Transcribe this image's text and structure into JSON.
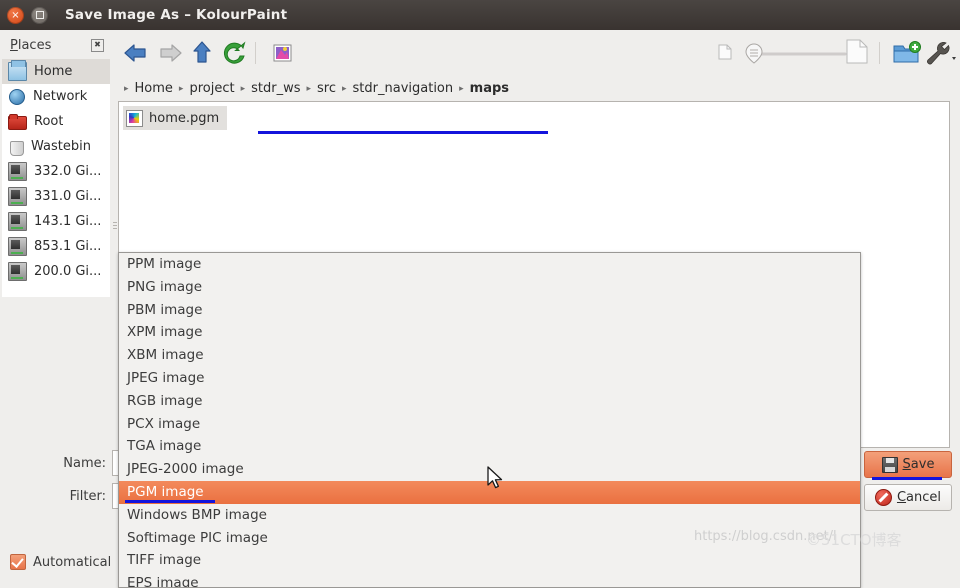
{
  "window": {
    "title": "Save Image As – KolourPaint",
    "close_icon": "window-close-icon",
    "maximize_icon": "window-maximize-icon"
  },
  "places": {
    "title": "Places",
    "close_icon": "places-close-icon",
    "items": [
      {
        "label": "Home",
        "icon": "home-icon",
        "selected": true
      },
      {
        "label": "Network",
        "icon": "network-icon",
        "selected": false
      },
      {
        "label": "Root",
        "icon": "root-folder-icon",
        "selected": false
      },
      {
        "label": "Wastebin",
        "icon": "trash-icon",
        "selected": false
      },
      {
        "label": "332.0 Gi...",
        "icon": "drive-icon",
        "selected": false
      },
      {
        "label": "331.0 Gi...",
        "icon": "drive-icon",
        "selected": false
      },
      {
        "label": "143.1 Gi...",
        "icon": "drive-removable-icon",
        "selected": false
      },
      {
        "label": "853.1 Gi...",
        "icon": "drive-removable-icon",
        "selected": false
      },
      {
        "label": "200.0 Gi...",
        "icon": "drive-icon",
        "selected": false
      }
    ]
  },
  "toolbar": {
    "back_icon": "back-arrow-icon",
    "forward_icon": "forward-arrow-icon",
    "up_icon": "up-arrow-icon",
    "reload_icon": "reload-icon",
    "preview_icon": "image-preview-icon",
    "zoom_small_icon": "small-document-icon",
    "zoom_large_icon": "large-document-icon",
    "zoom_slider_icon": "zoom-slider",
    "zoom_value": 0,
    "new_folder_icon": "new-folder-icon",
    "options_icon": "configure-wrench-icon",
    "options_dropdown_icon": "chevron-down-icon"
  },
  "breadcrumb": {
    "separator": "▸",
    "items": [
      {
        "label": "Home",
        "current": false
      },
      {
        "label": "project",
        "current": false
      },
      {
        "label": "stdr_ws",
        "current": false
      },
      {
        "label": "src",
        "current": false
      },
      {
        "label": "stdr_navigation",
        "current": false
      },
      {
        "label": "maps",
        "current": true
      }
    ]
  },
  "fileview": {
    "files": [
      {
        "name": "home.pgm",
        "icon": "image-file-icon",
        "selected": true
      }
    ]
  },
  "form": {
    "name_label": "Name:",
    "name_value": "",
    "filter_label": "Filter:",
    "filter_value": "PGM image"
  },
  "buttons": {
    "save_label": "Save",
    "save_accel": "S",
    "save_icon": "floppy-save-icon",
    "cancel_label": "Cancel",
    "cancel_accel": "C",
    "cancel_icon": "cancel-stop-icon"
  },
  "checkbox": {
    "label": "Automatically select filename extension",
    "truncated_label": "Automatical",
    "checked": true
  },
  "filter_dropdown": {
    "selected": "PGM image",
    "options": [
      "PPM image",
      "PNG image",
      "PBM image",
      "XPM image",
      "XBM image",
      "JPEG image",
      "RGB image",
      "PCX image",
      "TGA image",
      "JPEG-2000 image",
      "PGM image",
      "Windows BMP image",
      "Softimage PIC image",
      "TIFF image",
      "EPS image"
    ]
  },
  "watermark": {
    "url_text": "https://blog.csdn.net/l",
    "brand_text": "©51CTO博客"
  },
  "colors": {
    "accent_orange": "#ea7040",
    "titlebar": "#3b3532",
    "focus_blue": "#1414dc",
    "window_bg": "#efeeec"
  }
}
